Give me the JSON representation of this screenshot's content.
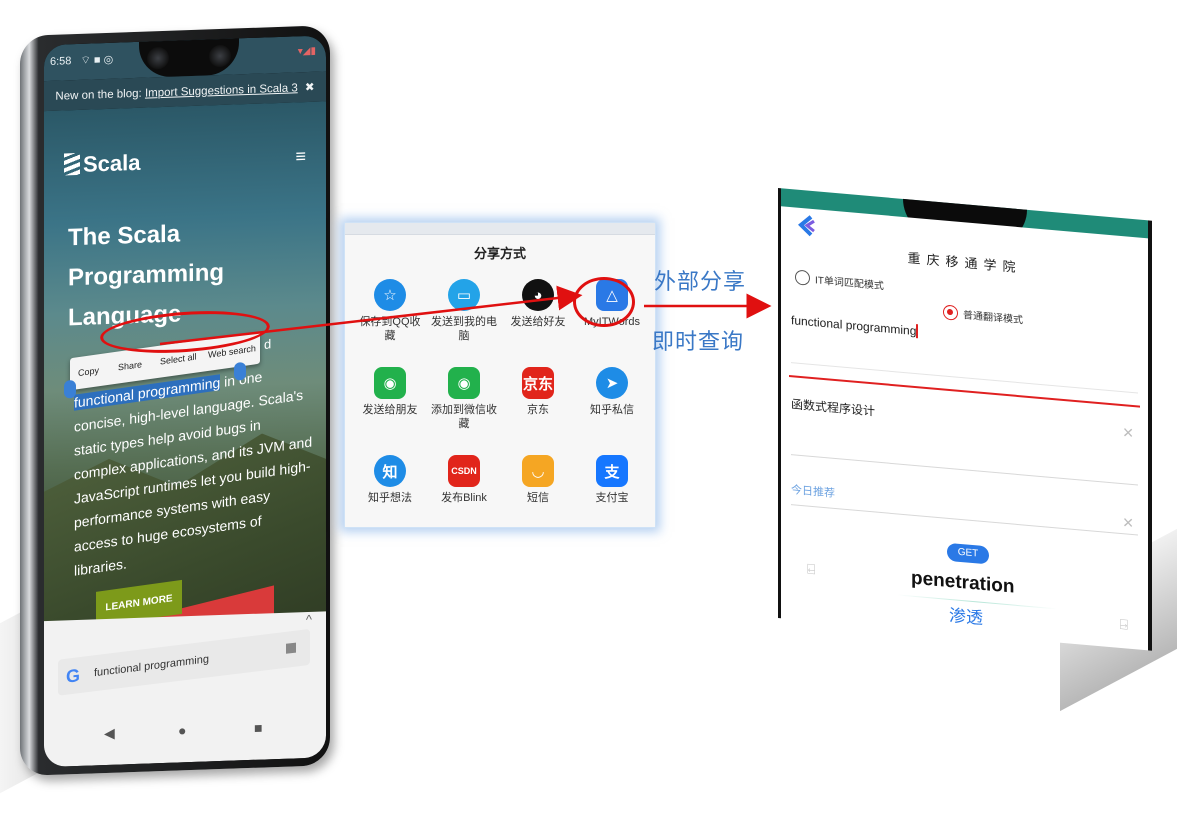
{
  "phone1": {
    "status_time": "6:58",
    "status_icons": "⌔ ■ ◎",
    "status_right": "▾◢▮",
    "banner_prefix": "New on the blog: ",
    "banner_link": "Import Suggestions in Scala 3",
    "banner_close": "✖",
    "logo": "Scala",
    "menu_glyph": "≡",
    "headline": "The Scala Programming Language",
    "context_menu": [
      "Copy",
      "Share",
      "Select all",
      "Web search"
    ],
    "body_selected": "functional programming",
    "body_trailing_fragment": "d",
    "body_rest": " in one concise, high-level language. Scala's static types help avoid bugs in complex applications, and its JVM and JavaScript runtimes let you build high-performance systems with easy access to huge ecosystems of libraries.",
    "learn_more": "LEARN MORE",
    "collapse_caret": "^",
    "google_glyph": "G",
    "search_query": "functional programming",
    "nav": {
      "back": "◀",
      "home": "●",
      "recents": "■"
    }
  },
  "share": {
    "title": "分享方式",
    "items": [
      {
        "label": "保存到QQ收藏",
        "icon": "qq-favorites-icon",
        "glyph": "☆",
        "color": "#1e8ce6",
        "round": true
      },
      {
        "label": "发送到我的电脑",
        "icon": "my-computer-icon",
        "glyph": "▭",
        "color": "#23a3e8",
        "round": true
      },
      {
        "label": "发送给好友",
        "icon": "qq-penguin-icon",
        "glyph": "◕",
        "color": "#111111",
        "round": true
      },
      {
        "label": "MyITWords",
        "icon": "myitwords-icon",
        "glyph": "△",
        "color": "#2a79e6",
        "round": false
      },
      {
        "label": "发送给朋友",
        "icon": "wechat-icon",
        "glyph": "◉",
        "color": "#22b14c",
        "round": false
      },
      {
        "label": "添加到微信收藏",
        "icon": "wechat-favorites-icon",
        "glyph": "◉",
        "color": "#22b14c",
        "round": false
      },
      {
        "label": "京东",
        "icon": "jd-icon",
        "glyph": "京东",
        "color": "#e1251b",
        "round": false
      },
      {
        "label": "知乎私信",
        "icon": "zhihu-message-icon",
        "glyph": "➤",
        "color": "#1e8ce6",
        "round": true
      },
      {
        "label": "知乎想法",
        "icon": "zhihu-icon",
        "glyph": "知",
        "color": "#1e8ce6",
        "round": true
      },
      {
        "label": "发布Blink",
        "icon": "csdn-icon",
        "glyph": "CSDN",
        "color": "#e1251b",
        "round": false
      },
      {
        "label": "短信",
        "icon": "sms-icon",
        "glyph": "◡",
        "color": "#f5a623",
        "round": false
      },
      {
        "label": "支付宝",
        "icon": "alipay-icon",
        "glyph": "支",
        "color": "#1677ff",
        "round": false
      }
    ]
  },
  "annotations": {
    "external_share": "外部分享",
    "instant_lookup": "即时查询"
  },
  "phone2": {
    "school": "重庆移通学院",
    "mode_it": "IT单词匹配模式",
    "mode_general": "普通翻译模式",
    "selected_mode": "普通翻译模式",
    "input_text": "functional programming",
    "result_text": "函数式程序设计",
    "clear_glyph": "✕",
    "daily_label": "今日推荐",
    "get_label": "GET",
    "word": "penetration",
    "meaning": "渗透",
    "prev_glyph": "⍇",
    "next_glyph": "⍈"
  },
  "colors": {
    "accent_red": "#e01010",
    "accent_blue": "#2a79e6",
    "annotation_blue": "#3a78c6",
    "header_teal": "#1f8b78"
  }
}
